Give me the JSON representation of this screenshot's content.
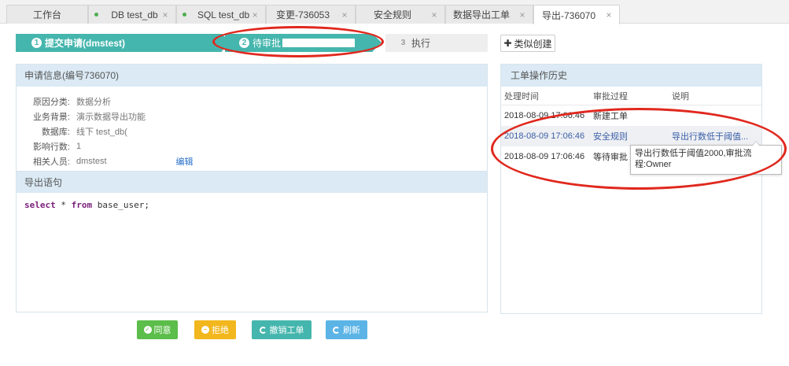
{
  "tabs": [
    {
      "label": "工作台",
      "dot": false,
      "close": false
    },
    {
      "label": "DB test_db",
      "dot": true,
      "close": true
    },
    {
      "label": "SQL test_db",
      "dot": true,
      "close": true
    },
    {
      "label": "变更-736053",
      "dot": false,
      "close": true
    },
    {
      "label": "安全规则",
      "dot": false,
      "close": true
    },
    {
      "label": "数据导出工单",
      "dot": false,
      "close": true
    },
    {
      "label": "导出-736070",
      "dot": false,
      "close": true,
      "active": true
    }
  ],
  "close_glyph": "×",
  "steps": [
    {
      "num": "1",
      "label": "提交申请(dmstest)"
    },
    {
      "num": "2",
      "label": "待审批"
    },
    {
      "num": "3",
      "label": "执行"
    }
  ],
  "similar_button": {
    "plus": "✚",
    "label": "类似创建"
  },
  "info": {
    "title": "申请信息(编号736070)",
    "rows": [
      {
        "key": "原因分类:",
        "value": "数据分析"
      },
      {
        "key": "业务背景:",
        "value": "演示数据导出功能"
      },
      {
        "key": "数据库:",
        "value": "线下 test_db("
      },
      {
        "key": "影响行数:",
        "value": "1"
      },
      {
        "key": "相关人员:",
        "value": "dmstest",
        "edit": "编辑"
      }
    ]
  },
  "export": {
    "title": "导出语句",
    "sql": {
      "kw1": "select",
      "star": " * ",
      "kw2": "from",
      "rest": " base_user;"
    }
  },
  "history": {
    "title": "工单操作历史",
    "columns": [
      "处理时间",
      "审批过程",
      "说明"
    ],
    "rows": [
      {
        "time": "2018-08-09 17:06:46",
        "step": "新建工单",
        "note": ""
      },
      {
        "time": "2018-08-09 17:06:46",
        "step": "安全规则",
        "note": "导出行数低于阈值..."
      },
      {
        "time": "2018-08-09 17:06:46",
        "step": "等待审批",
        "note": ""
      }
    ],
    "tooltip": "导出行数低于阈值2000,审批流程:Owner"
  },
  "actions": {
    "approve": "同意",
    "reject": "拒绝",
    "revoke": "撤销工单",
    "refresh": "刷新"
  },
  "colors": {
    "accent": "#45b6ad",
    "approve": "#5bbd4a",
    "reject": "#f2b71d",
    "refresh": "#5bb4e5",
    "annotation": "#e0281e"
  }
}
